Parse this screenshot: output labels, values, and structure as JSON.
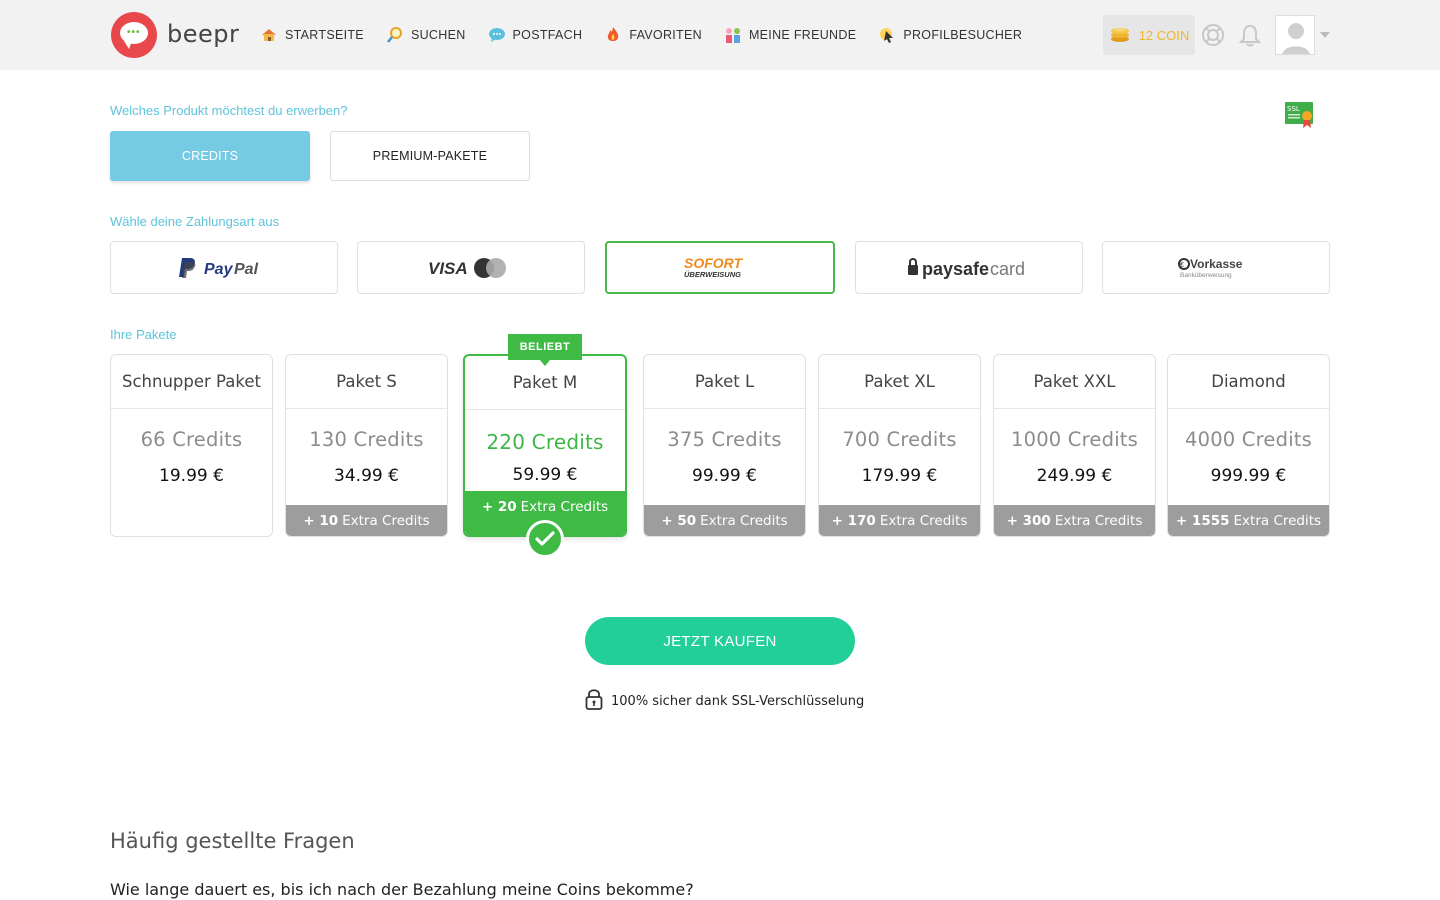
{
  "brand": {
    "name": "beepr"
  },
  "nav": [
    {
      "label": "STARTSEITE",
      "icon": "house-icon"
    },
    {
      "label": "SUCHEN",
      "icon": "magnifier-icon"
    },
    {
      "label": "POSTFACH",
      "icon": "chat-icon"
    },
    {
      "label": "FAVORITEN",
      "icon": "flame-icon"
    },
    {
      "label": "MEINE FREUNDE",
      "icon": "friends-icon"
    },
    {
      "label": "PROFILBESUCHER",
      "icon": "visitor-icon"
    }
  ],
  "header": {
    "coins": "12 COIN"
  },
  "product": {
    "question": "Welches Produkt möchtest du erwerben?",
    "options": [
      "CREDITS",
      "PREMIUM-PAKETE"
    ],
    "selected": "CREDITS"
  },
  "payment": {
    "label": "Wähle deine Zahlungsart aus",
    "methods": [
      {
        "name": "PayPal"
      },
      {
        "name": "VISA"
      },
      {
        "name": "SOFORT",
        "sub": "ÜBERWEISUNG",
        "selected": true
      },
      {
        "name": "paysafecard"
      },
      {
        "name": "Vorkasse",
        "sub": "Banküberweisung"
      }
    ]
  },
  "packages": {
    "label": "Ihre Pakete",
    "badge": "BELIEBT",
    "items": [
      {
        "name": "Schnupper Paket",
        "credits": "66 Credits",
        "price": "19.99 €",
        "extra": ""
      },
      {
        "name": "Paket S",
        "credits": "130 Credits",
        "price": "34.99 €",
        "extra_num": "+ 10",
        "extra": "Extra Credits"
      },
      {
        "name": "Paket M",
        "credits": "220 Credits",
        "price": "59.99 €",
        "extra_num": "+ 20",
        "extra": "Extra Credits",
        "selected": true
      },
      {
        "name": "Paket L",
        "credits": "375 Credits",
        "price": "99.99 €",
        "extra_num": "+ 50",
        "extra": "Extra Credits"
      },
      {
        "name": "Paket XL",
        "credits": "700 Credits",
        "price": "179.99 €",
        "extra_num": "+ 170",
        "extra": "Extra Credits"
      },
      {
        "name": "Paket XXL",
        "credits": "1000 Credits",
        "price": "249.99 €",
        "extra_num": "+ 300",
        "extra": "Extra Credits"
      },
      {
        "name": "Diamond",
        "credits": "4000 Credits",
        "price": "999.99 €",
        "extra_num": "+ 1555",
        "extra": "Extra Credits"
      }
    ]
  },
  "checkout": {
    "button": "JETZT KAUFEN",
    "secure_text": "100% sicher dank SSL-Verschlüsselung"
  },
  "faq": {
    "title": "Häufig gestellte Fragen",
    "questions": [
      "Wie lange dauert es, bis ich nach der Bezahlung meine Coins bekomme?"
    ]
  },
  "colors": {
    "accent_cyan": "#74cbe3",
    "selected_green": "#3fbb45",
    "buy_button": "#23cf98",
    "coin_gold": "#f0b42c"
  }
}
